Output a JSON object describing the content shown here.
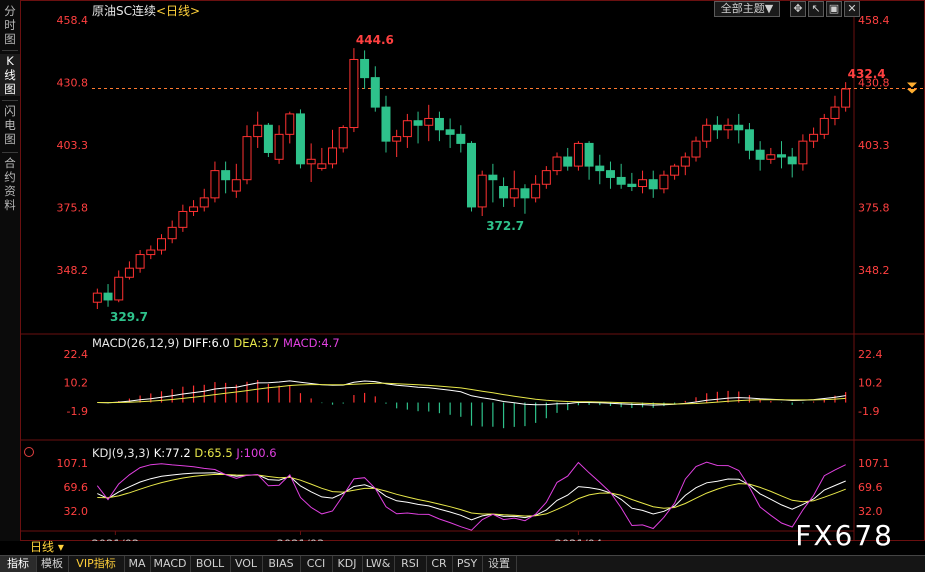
{
  "side_tabs": [
    "分时图",
    "K线图",
    "闪电图",
    "合约资料"
  ],
  "active_side_tab": 1,
  "title": {
    "name": "原油SC连续",
    "period": "<日线>"
  },
  "toolbar": {
    "theme_label": "全部主题▼",
    "icons": [
      "crosshair-icon",
      "cursor-icon",
      "maximize-icon",
      "close-icon"
    ]
  },
  "price_axis": {
    "ticks": [
      "458.4",
      "430.8",
      "403.3",
      "375.8",
      "348.2"
    ],
    "tick_values": [
      458.4,
      430.8,
      403.3,
      375.8,
      348.2
    ],
    "current_price": "432.4",
    "current_line_value": 428.2
  },
  "price_annotations": {
    "high": "444.6",
    "low_mid": "372.7",
    "low_start": "329.7",
    "last": "432.4"
  },
  "macd": {
    "label": "MACD(26,12,9)",
    "diff": "DIFF:6.0",
    "dea": "DEA:3.7",
    "macd": "MACD:4.7",
    "ticks": [
      "22.4",
      "10.2",
      "-1.9"
    ],
    "diff_color": "#ffffff",
    "dea_color": "#e8e84a",
    "macd_color": "#e040e0"
  },
  "kdj": {
    "label": "KDJ(9,3,3)",
    "k": "K:77.2",
    "d": "D:65.5",
    "j": "J:100.6",
    "ticks": [
      "107.1",
      "69.6",
      "32.0"
    ],
    "k_color": "#ffffff",
    "d_color": "#e8e84a",
    "j_color": "#e040e0"
  },
  "date_labels": [
    "2021/02",
    "2021/03",
    "2021/04"
  ],
  "period_label": "日线",
  "bottom_tabs": [
    "指标",
    "模板",
    "VIP指标",
    "MA",
    "MACD",
    "BOLL",
    "VOL",
    "BIAS",
    "CCI",
    "KDJ",
    "LW&",
    "RSI",
    "CR",
    "PSY",
    "设置"
  ],
  "watermark": "FX678",
  "colors": {
    "up": "#ff3232",
    "down": "#2ec28b",
    "grid": "#5a1010",
    "axis_text": "#ff4040",
    "dash_line": "#ff7a30"
  },
  "chart_data": {
    "type": "candlestick",
    "ohlc": [
      [
        334,
        340,
        331,
        338
      ],
      [
        338,
        342,
        332,
        335
      ],
      [
        335,
        348,
        334,
        345
      ],
      [
        345,
        352,
        344,
        349
      ],
      [
        349,
        357,
        347,
        355
      ],
      [
        355,
        359,
        353,
        357
      ],
      [
        357,
        364,
        355,
        362
      ],
      [
        362,
        370,
        360,
        367
      ],
      [
        367,
        377,
        365,
        374
      ],
      [
        374,
        379,
        372,
        376
      ],
      [
        376,
        384,
        374,
        380
      ],
      [
        380,
        396,
        378,
        392
      ],
      [
        392,
        396,
        382,
        388
      ],
      [
        383,
        395,
        380,
        388
      ],
      [
        388,
        412,
        386,
        407
      ],
      [
        407,
        418,
        402,
        412
      ],
      [
        412,
        413,
        398,
        400
      ],
      [
        397,
        412,
        395,
        408
      ],
      [
        408,
        418,
        404,
        417
      ],
      [
        417,
        419,
        393,
        395
      ],
      [
        395,
        404,
        387,
        397
      ],
      [
        393,
        402,
        392,
        395
      ],
      [
        395,
        410,
        393,
        402
      ],
      [
        402,
        412,
        400,
        411
      ],
      [
        411,
        446,
        409,
        441
      ],
      [
        441,
        445,
        428,
        433
      ],
      [
        433,
        438,
        418,
        420
      ],
      [
        420,
        425,
        400,
        405
      ],
      [
        405,
        410,
        398,
        407
      ],
      [
        407,
        417,
        402,
        414
      ],
      [
        414,
        418,
        404,
        412
      ],
      [
        412,
        421,
        405,
        415
      ],
      [
        415,
        418,
        405,
        410
      ],
      [
        410,
        415,
        402,
        408
      ],
      [
        408,
        412,
        400,
        404
      ],
      [
        404,
        405,
        374,
        376
      ],
      [
        376,
        392,
        372,
        390
      ],
      [
        390,
        395,
        378,
        388
      ],
      [
        385,
        389,
        376,
        380
      ],
      [
        380,
        392,
        376,
        384
      ],
      [
        384,
        386,
        373,
        380
      ],
      [
        380,
        390,
        378,
        386
      ],
      [
        386,
        394,
        384,
        392
      ],
      [
        392,
        400,
        390,
        398
      ],
      [
        398,
        402,
        392,
        394
      ],
      [
        394,
        405,
        392,
        404
      ],
      [
        404,
        405,
        388,
        394
      ],
      [
        394,
        399,
        386,
        392
      ],
      [
        392,
        396,
        384,
        389
      ],
      [
        389,
        395,
        384,
        386
      ],
      [
        386,
        391,
        383,
        385
      ],
      [
        385,
        392,
        382,
        388
      ],
      [
        388,
        392,
        380,
        384
      ],
      [
        384,
        392,
        382,
        390
      ],
      [
        390,
        395,
        388,
        394
      ],
      [
        394,
        400,
        390,
        398
      ],
      [
        398,
        407,
        396,
        405
      ],
      [
        405,
        415,
        402,
        412
      ],
      [
        412,
        416,
        406,
        410
      ],
      [
        410,
        415,
        406,
        412
      ],
      [
        412,
        417,
        404,
        410
      ],
      [
        410,
        413,
        397,
        401
      ],
      [
        401,
        405,
        392,
        397
      ],
      [
        397,
        402,
        395,
        399
      ],
      [
        399,
        405,
        393,
        398
      ],
      [
        398,
        402,
        389,
        395
      ],
      [
        395,
        408,
        392,
        405
      ],
      [
        405,
        411,
        402,
        408
      ],
      [
        408,
        417,
        406,
        415
      ],
      [
        415,
        425,
        412,
        420
      ],
      [
        420,
        431,
        418,
        428
      ]
    ]
  }
}
